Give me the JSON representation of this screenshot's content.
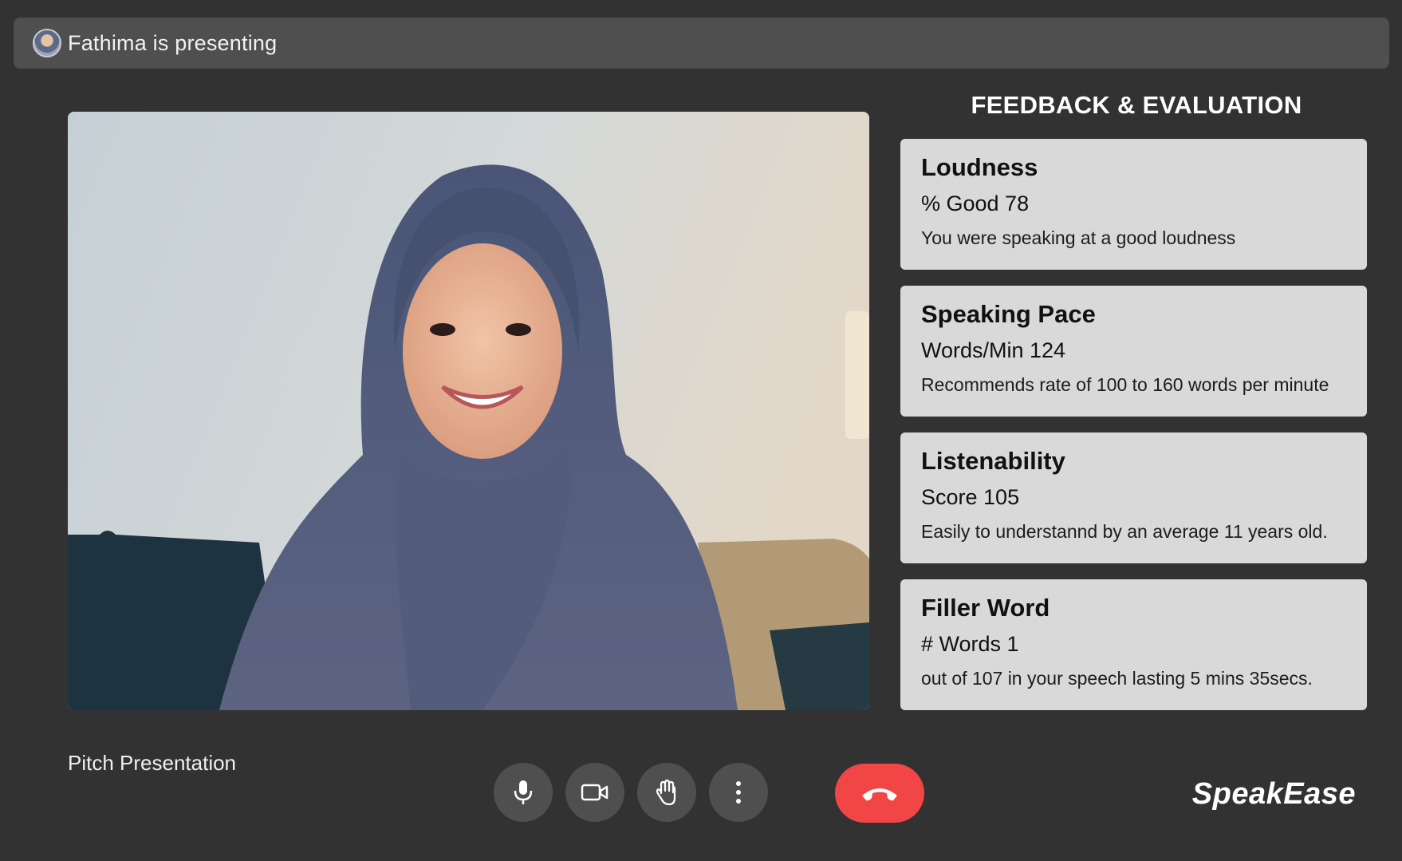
{
  "banner": {
    "presenter_text": "Fathima is presenting",
    "avatar_icon": "user-avatar"
  },
  "panel": {
    "title": "FEEDBACK & EVALUATION",
    "cards": [
      {
        "title": "Loudness",
        "metric": "% Good 78",
        "description": "You were speaking at a good loudness"
      },
      {
        "title": "Speaking Pace",
        "metric": "Words/Min 124",
        "description": "Recommends rate of 100 to 160 words per minute"
      },
      {
        "title": "Listenability",
        "metric": "Score 105",
        "description": "Easily to understannd by an average 11 years old."
      },
      {
        "title": "Filler Word",
        "metric": "# Words 1",
        "description": "out of 107 in your speech lasting 5 mins 35secs."
      }
    ]
  },
  "footer": {
    "meeting_title": "Pitch Presentation",
    "brand": "SpeakEase",
    "controls": [
      {
        "icon": "microphone-icon"
      },
      {
        "icon": "camera-icon"
      },
      {
        "icon": "raise-hand-icon"
      },
      {
        "icon": "more-options-icon"
      },
      {
        "icon": "end-call-icon",
        "color": "#f24545"
      }
    ]
  },
  "colors": {
    "background": "#323232",
    "banner": "#4f4f4f",
    "card": "#d9d9d9",
    "end_call": "#f24545"
  }
}
